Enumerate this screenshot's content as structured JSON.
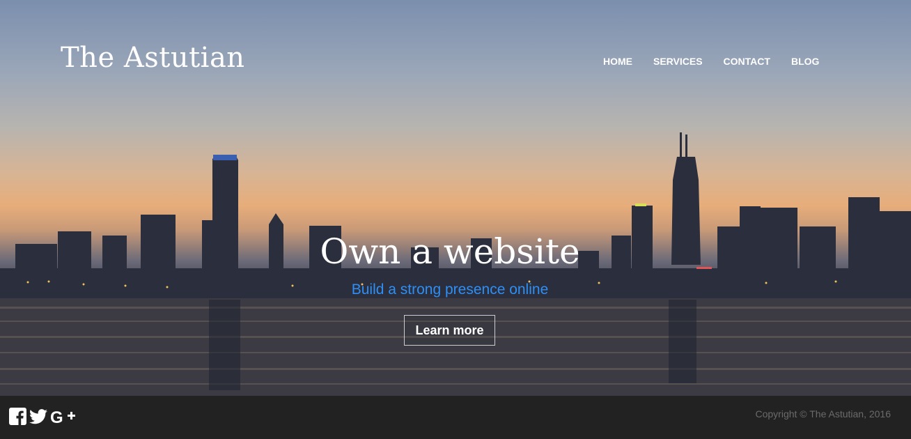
{
  "header": {
    "brand": "The Astutian",
    "nav": [
      "HOME",
      "SERVICES",
      "CONTACT",
      "BLOG"
    ]
  },
  "hero": {
    "title": "Own a website",
    "subtitle": "Build a strong presence online",
    "cta_label": "Learn more"
  },
  "footer": {
    "social_icons": [
      "facebook-icon",
      "twitter-icon",
      "google-plus-icon"
    ],
    "copyright": "Copyright © The Astutian, 2016"
  },
  "colors": {
    "accent": "#2e8ff5",
    "footer_bg": "#222222",
    "footer_text": "#6b6b6b"
  }
}
